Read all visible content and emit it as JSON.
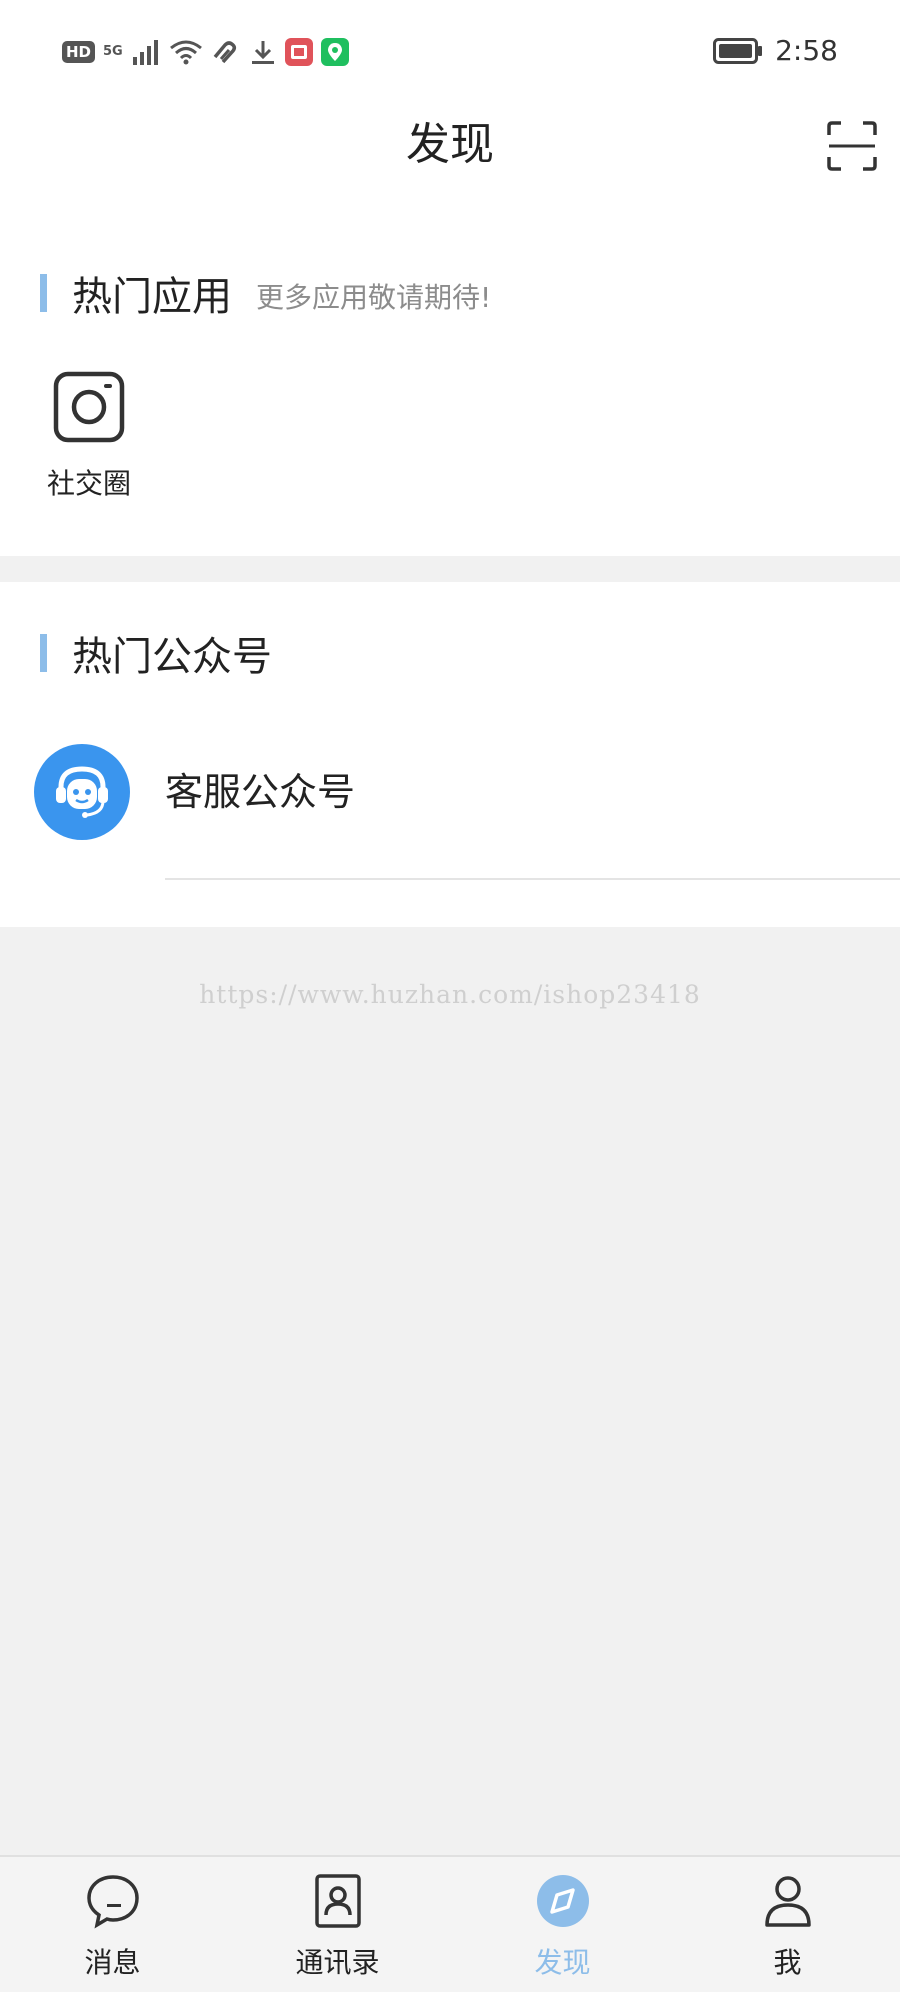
{
  "status_bar": {
    "time": "2:58",
    "network_badge": "HD",
    "signal_type": "5G"
  },
  "header": {
    "title": "发现"
  },
  "hot_apps": {
    "title": "热门应用",
    "subtitle": "更多应用敬请期待!",
    "items": [
      {
        "label": "社交圈",
        "icon": "camera-icon"
      }
    ]
  },
  "hot_official_accounts": {
    "title": "热门公众号",
    "items": [
      {
        "name": "客服公众号",
        "icon": "customer-service-icon"
      }
    ]
  },
  "watermark": "https://www.huzhan.com/ishop23418",
  "tabs": [
    {
      "label": "消息",
      "icon": "chat-bubble-icon",
      "active": false
    },
    {
      "label": "通讯录",
      "icon": "contacts-icon",
      "active": false
    },
    {
      "label": "发现",
      "icon": "compass-icon",
      "active": true
    },
    {
      "label": "我",
      "icon": "person-icon",
      "active": false
    }
  ],
  "colors": {
    "accent": "#8dbde9",
    "avatar_blue": "#3a95ee",
    "background": "#f1f1f1"
  }
}
